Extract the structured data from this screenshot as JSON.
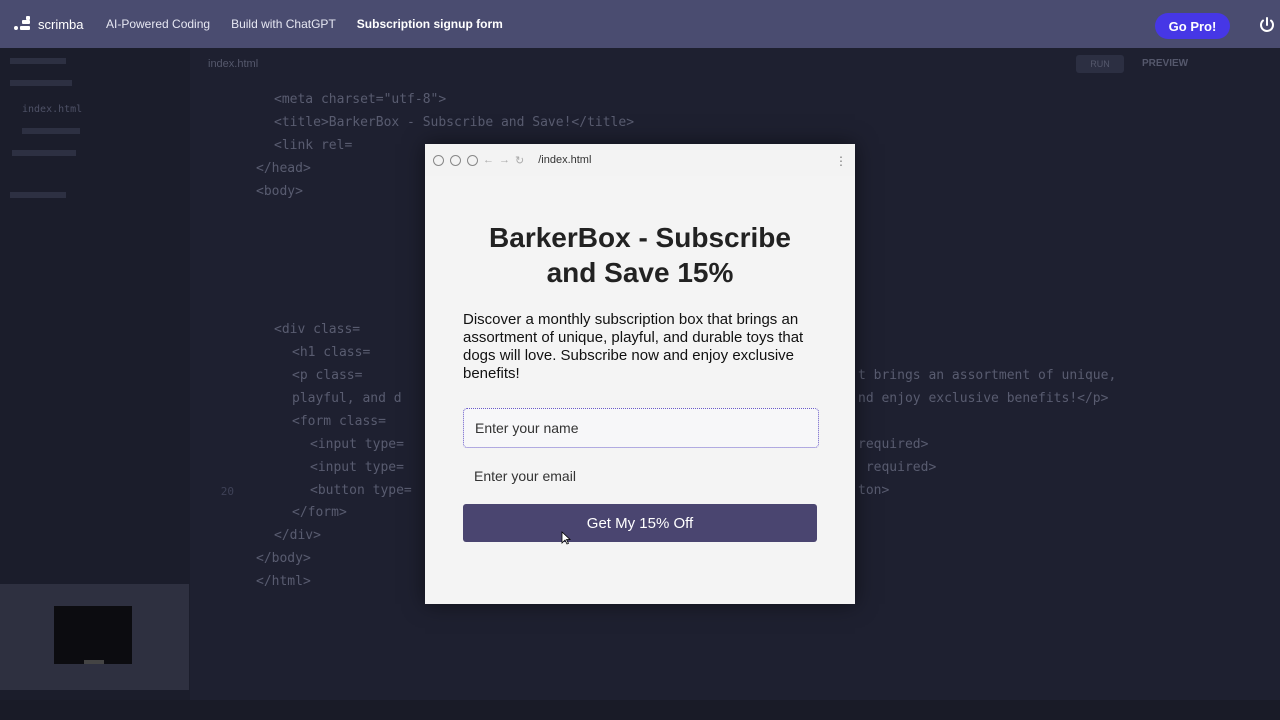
{
  "nav": {
    "logo_text": "scrimba",
    "breadcrumbs": [
      "AI-Powered Coding",
      "Build with ChatGPT",
      "Subscription signup form"
    ],
    "go_pro_label": "Go Pro!"
  },
  "editor": {
    "file_tab": "index.html",
    "sidebar_file": "index.html",
    "run_label": "RUN",
    "preview_label": "PREVIEW",
    "code_lines": [
      "<meta charset=\"utf-8\">",
      "<title>BarkerBox - Subscribe and Save!</title>",
      "<link rel=",
      "</head>",
      "<body>",
      "<div class=",
      "<h1 class=",
      "<p class=",
      "playful, and d",
      "<form class=",
      "<input type=",
      "<input type=",
      "<button type=",
      "</form>",
      "</div>",
      "</body>",
      "</html>"
    ],
    "code_right": [
      "t brings an assortment of unique,",
      "nd enjoy exclusive benefits!</p>",
      "required>",
      " required>",
      "ton>"
    ],
    "visible_line_number": "20"
  },
  "preview": {
    "url": "/index.html",
    "headline": "BarkerBox - Subscribe and Save 15%",
    "description": "Discover a monthly subscription box that brings an assortment of unique, playful, and durable toys that dogs will love. Subscribe now and enjoy exclusive benefits!",
    "name_placeholder": "Enter your name",
    "email_placeholder": "Enter your email",
    "cta_label": "Get My 15% Off"
  },
  "colors": {
    "nav_bg": "#4a4c70",
    "go_pro": "#4637e6",
    "cta_bg": "#4a4570",
    "focus_border": "#6a5cc9"
  }
}
